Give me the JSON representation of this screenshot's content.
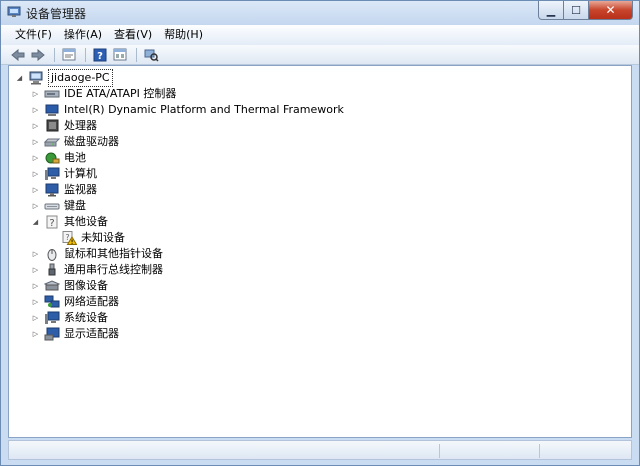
{
  "window": {
    "title": "设备管理器"
  },
  "menu": [
    {
      "label": "文件(F)"
    },
    {
      "label": "操作(A)"
    },
    {
      "label": "查看(V)"
    },
    {
      "label": "帮助(H)"
    }
  ],
  "toolbar": [
    "back-icon",
    "forward-icon",
    "properties-icon",
    "help-icon",
    "view-icon",
    "scan-hardware-icon"
  ],
  "tree": {
    "root": {
      "label": "jidaoge-PC",
      "expanded": true,
      "icon": "computer-icon"
    },
    "items": [
      {
        "label": "IDE ATA/ATAPI 控制器",
        "icon": "ide-controller-icon",
        "expanded": false
      },
      {
        "label": "Intel(R) Dynamic Platform and Thermal Framework",
        "icon": "intel-framework-icon",
        "expanded": false
      },
      {
        "label": "处理器",
        "icon": "processor-icon",
        "expanded": false
      },
      {
        "label": "磁盘驱动器",
        "icon": "disk-drive-icon",
        "expanded": false
      },
      {
        "label": "电池",
        "icon": "battery-icon",
        "expanded": false
      },
      {
        "label": "计算机",
        "icon": "computer-icon",
        "expanded": false
      },
      {
        "label": "监视器",
        "icon": "monitor-icon",
        "expanded": false
      },
      {
        "label": "键盘",
        "icon": "keyboard-icon",
        "expanded": false
      },
      {
        "label": "其他设备",
        "icon": "other-devices-icon",
        "expanded": true,
        "children": [
          {
            "label": "未知设备",
            "icon": "unknown-device-warning-icon"
          }
        ]
      },
      {
        "label": "鼠标和其他指针设备",
        "icon": "mouse-icon",
        "expanded": false
      },
      {
        "label": "通用串行总线控制器",
        "icon": "usb-controller-icon",
        "expanded": false
      },
      {
        "label": "图像设备",
        "icon": "imaging-device-icon",
        "expanded": false
      },
      {
        "label": "网络适配器",
        "icon": "network-adapter-icon",
        "expanded": false
      },
      {
        "label": "系统设备",
        "icon": "system-device-icon",
        "expanded": false
      },
      {
        "label": "显示适配器",
        "icon": "display-adapter-icon",
        "expanded": false
      }
    ]
  },
  "colors": {
    "titlebar": "#c4d7ef",
    "close_button": "#c8452c",
    "warning": "#f2c200"
  }
}
